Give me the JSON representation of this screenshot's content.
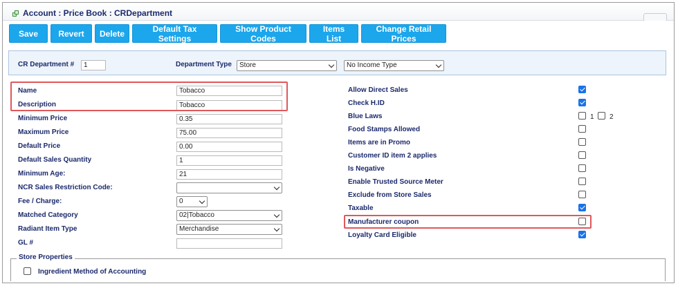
{
  "header": {
    "title": "Account : Price Book : CRDepartment"
  },
  "toolbar": {
    "save": "Save",
    "revert": "Revert",
    "delete": "Delete",
    "default_tax": "Default Tax Settings",
    "show_codes": "Show Product Codes",
    "items_list": "Items List",
    "change_prices": "Change Retail Prices"
  },
  "dept": {
    "number_label": "CR Department #",
    "number_value": "1",
    "type_label": "Department Type",
    "type_value": "Store",
    "income_value": "No Income Type"
  },
  "left": {
    "name_label": "Name",
    "name_value": "Tobacco",
    "desc_label": "Description",
    "desc_value": "Tobacco",
    "min_price_label": "Minimum Price",
    "min_price_value": "0.35",
    "max_price_label": "Maximum Price",
    "max_price_value": "75.00",
    "default_price_label": "Default Price",
    "default_price_value": "0.00",
    "default_qty_label": "Default Sales Quantity",
    "default_qty_value": "1",
    "min_age_label": "Minimum Age:",
    "min_age_value": "21",
    "ncr_label": "NCR Sales Restriction Code:",
    "ncr_value": "",
    "fee_label": "Fee / Charge:",
    "fee_value": "0",
    "matched_label": "Matched Category",
    "matched_value": "02|Tobacco",
    "radiant_label": "Radiant Item Type",
    "radiant_value": "Merchandise",
    "gl_label": "GL #",
    "gl_value": ""
  },
  "right": {
    "allow_direct": "Allow Direct Sales",
    "check_hid": "Check H.ID",
    "blue_laws": "Blue Laws",
    "blue_1": "1",
    "blue_2": "2",
    "food_stamps": "Food Stamps Allowed",
    "promo": "Items are in Promo",
    "customer_id": "Customer ID item 2 applies",
    "negative": "Is Negative",
    "trusted": "Enable Trusted Source Meter",
    "exclude": "Exclude from Store Sales",
    "taxable": "Taxable",
    "manufacturer": "Manufacturer coupon",
    "loyalty": "Loyalty Card Eligible"
  },
  "store_props": {
    "legend": "Store Properties",
    "ingredient": "Ingredient Method of Accounting"
  },
  "colors": {
    "accent": "#1ca6ec",
    "label": "#1b2a6b",
    "highlight": "#e0575a",
    "check": "#1a73e8"
  }
}
